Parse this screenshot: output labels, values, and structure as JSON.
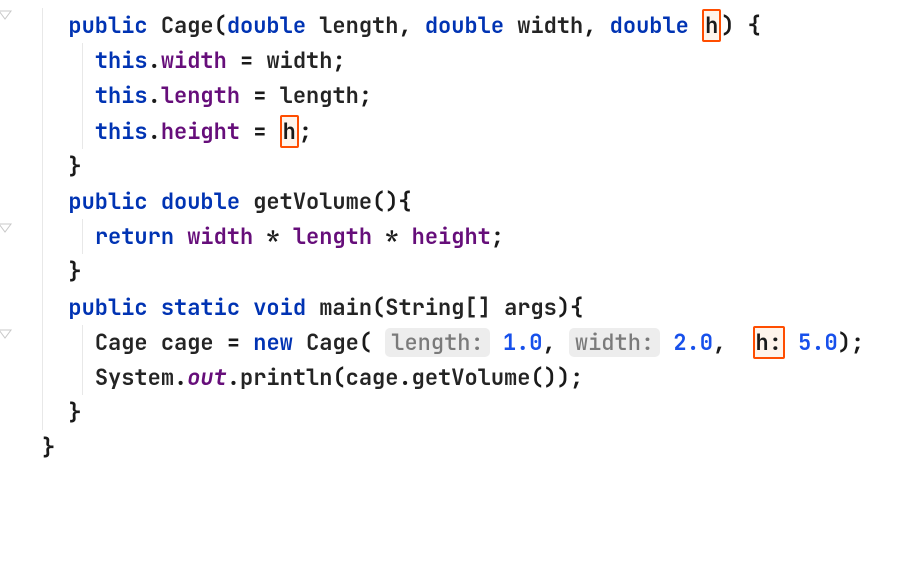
{
  "code": {
    "kw_public": "public",
    "kw_double": "double",
    "kw_static": "static",
    "kw_void": "void",
    "kw_return": "return",
    "kw_new": "new",
    "kw_this": "this",
    "ctor_name": "Cage",
    "param_length": "length",
    "param_width": "width",
    "param_h": "h",
    "fld_width": "width",
    "fld_length": "length",
    "fld_height": "height",
    "method_getVolume": "getVolume",
    "method_main": "main",
    "type_String_arr": "String[]",
    "args": "args",
    "var_cage": "cage",
    "sys": "System",
    "out": "out",
    "println": "println",
    "hint_length": "length:",
    "hint_width": "width:",
    "hint_h": "h:",
    "lit_1": "1.0",
    "lit_2": "2.0",
    "lit_5": "5.0"
  },
  "chart_data": null
}
